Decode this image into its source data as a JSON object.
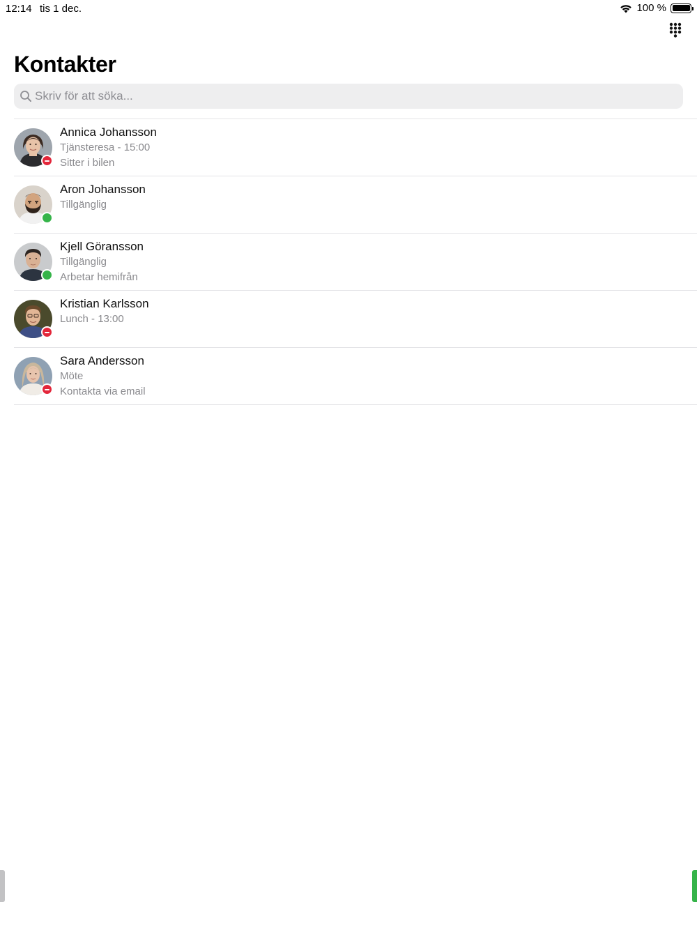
{
  "status_bar": {
    "time": "12:14",
    "date": "tis 1 dec.",
    "battery": "100 %",
    "wifi_icon": "wifi-icon",
    "battery_icon": "battery-icon"
  },
  "toolbar": {
    "dialpad_icon": "dialpad-icon"
  },
  "page": {
    "title": "Kontakter"
  },
  "search": {
    "placeholder": "Skriv för att söka...",
    "value": ""
  },
  "colors": {
    "available": "#35b449",
    "busy": "#e3263a",
    "secondary_text": "#8a8a8e",
    "search_background": "#eeeeef"
  },
  "contacts": [
    {
      "name": "Annica Johansson",
      "status": "Tjänsteresa - 15:00",
      "note": "Sitter i bilen",
      "presence": "busy"
    },
    {
      "name": "Aron Johansson",
      "status": "Tillgänglig",
      "note": "",
      "presence": "available"
    },
    {
      "name": "Kjell Göransson",
      "status": "Tillgänglig",
      "note": "Arbetar hemifrån",
      "presence": "available"
    },
    {
      "name": "Kristian Karlsson",
      "status": "Lunch - 13:00",
      "note": "",
      "presence": "busy"
    },
    {
      "name": "Sara Andersson",
      "status": "Möte",
      "note": "Kontakta via email",
      "presence": "busy"
    }
  ]
}
